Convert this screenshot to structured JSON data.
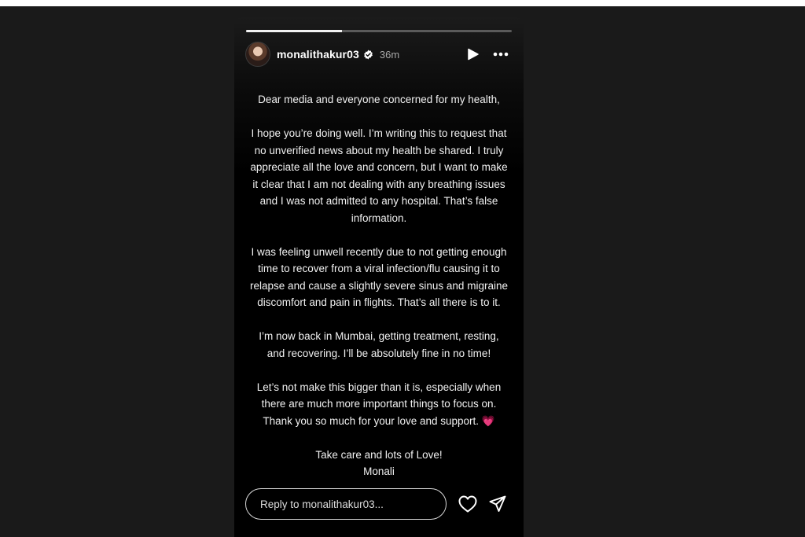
{
  "story": {
    "progress": 0.36,
    "user": {
      "username": "monalithakur03",
      "verified": true,
      "time_ago": "36m",
      "avatar_icon": "profile-photo"
    },
    "controls": {
      "play_icon": "play-icon",
      "more_icon": "more-options-icon"
    },
    "message": {
      "greeting": "Dear media and everyone concerned for my health,",
      "paragraph_1": "I hope you’re doing well. I’m writing this to request that no unverified news about my health be shared. I truly appreciate all the love and concern, but I want to make it clear that I am not dealing with any breathing issues and I was not admitted to any hospital. That’s false information.",
      "paragraph_2": "I was feeling unwell recently due to not getting enough time to recover from a viral infection/flu causing it to relapse and cause a slightly severe sinus and migraine discomfort and pain in flights. That’s all there is to it.",
      "paragraph_3": "I’m now back in Mumbai, getting treatment, resting, and recovering. I’ll be absolutely fine in no time!",
      "paragraph_4": "Let’s not make this bigger than it is, especially when there are much more important things to focus on. Thank you so much for your love and support.",
      "paragraph_4_emoji": "💗",
      "signoff": "Take care and lots of Love!",
      "signature": "Monali"
    },
    "footer": {
      "reply_placeholder": "Reply to monalithakur03...",
      "like_icon": "heart-icon",
      "share_icon": "send-icon"
    }
  },
  "colors": {
    "background": "#1a1a1a",
    "story_background": "#000000",
    "text": "#f1f1f1",
    "muted": "#a8a8a8",
    "emoji_pink": "#ff4fa3"
  }
}
